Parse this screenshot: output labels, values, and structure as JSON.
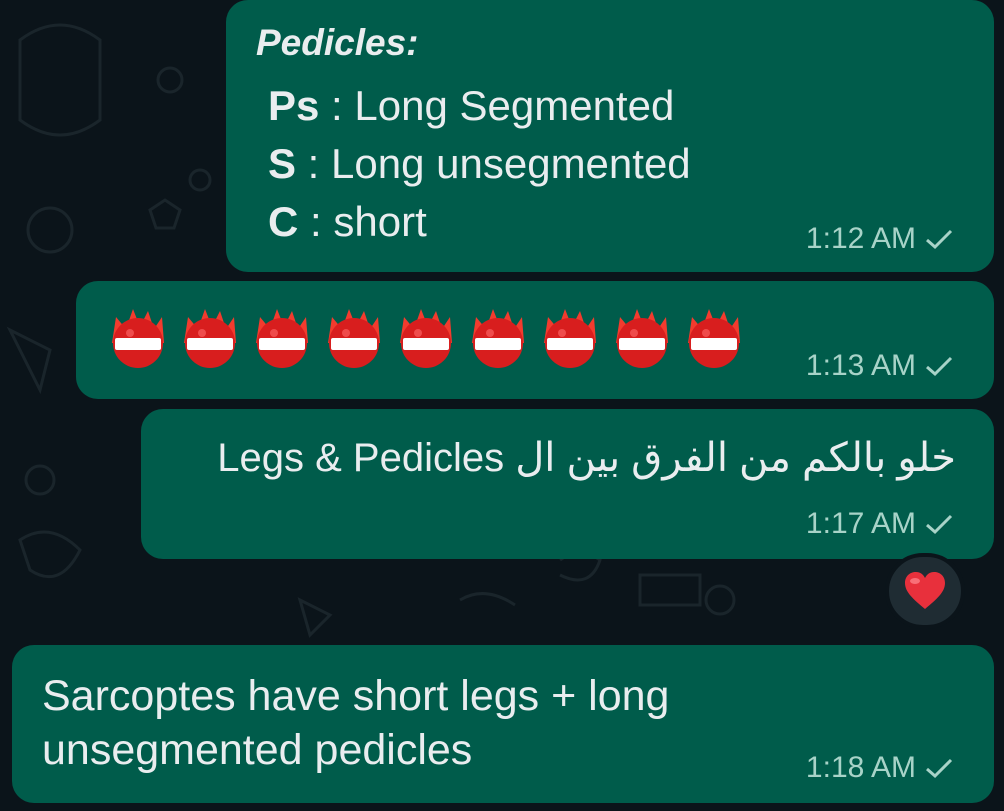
{
  "messages": [
    {
      "title": "Pedicles:",
      "lines": [
        {
          "key": "Ps",
          "sep": " : ",
          "value": "Long Segmented"
        },
        {
          "key": "S",
          "sep": " : ",
          "value": "Long unsegmented"
        },
        {
          "key": "C",
          "sep": " : ",
          "value": "short"
        }
      ],
      "time": "1:12 AM",
      "status_icon": "single-check-icon"
    },
    {
      "emoji_name": "fire-flag-emoji",
      "emoji_count": 9,
      "time": "1:13 AM",
      "status_icon": "single-check-icon"
    },
    {
      "text": "خلو بالكم من الفرق بين ال Legs & Pedicles",
      "time": "1:17 AM",
      "status_icon": "single-check-icon",
      "reaction": "❤️",
      "reaction_icon": "red-heart-icon"
    },
    {
      "text": "Sarcoptes have short legs + long unsegmented pedicles",
      "time": "1:18 AM",
      "status_icon": "single-check-icon"
    }
  ],
  "colors": {
    "background": "#0b141a",
    "outgoing_bubble": "#005c4b",
    "text": "#e9edef",
    "meta": "#a8d3c8",
    "reaction_bg": "#1f2c33",
    "heart": "#e8303c"
  }
}
